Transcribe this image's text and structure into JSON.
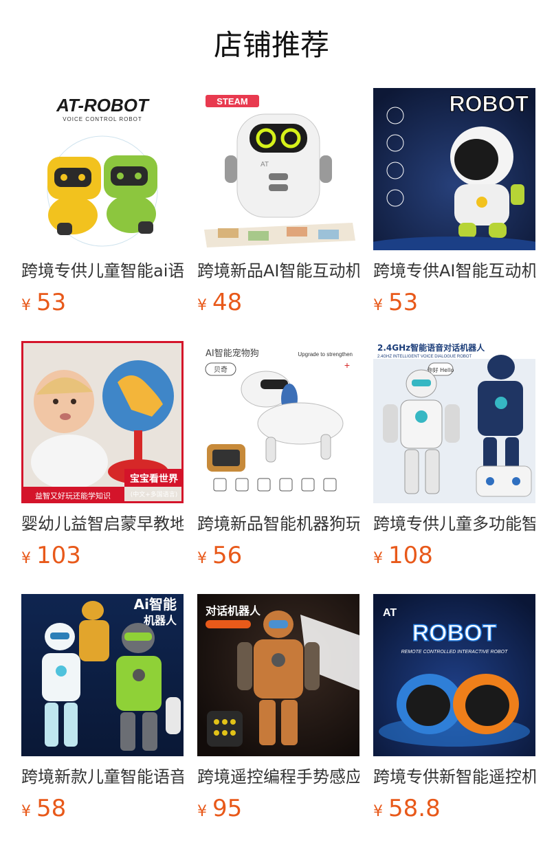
{
  "page": {
    "title": "店铺推荐"
  },
  "colors": {
    "price": "#e8591a",
    "title": "#111111"
  },
  "products": [
    {
      "name": "跨境专供儿童智能ai语音对话机器人",
      "currency": "¥",
      "price": "53",
      "image_text": [
        "AT-ROBOT",
        "VOICE CONTROL ROBOT"
      ]
    },
    {
      "name": "跨境新品AI智能互动机器人",
      "currency": "¥",
      "price": "48",
      "image_text": [
        "STEAM",
        "AT"
      ]
    },
    {
      "name": "跨境专供AI智能互动机器人",
      "currency": "¥",
      "price": "53",
      "image_text": [
        "ROBOT"
      ]
    },
    {
      "name": "婴幼儿益智启蒙早教地球仪",
      "currency": "¥",
      "price": "103",
      "image_text": [
        "宝宝看世界",
        "(中文+多国语言)",
        "益智又好玩还能学知识"
      ]
    },
    {
      "name": "跨境新品智能机器狗玩具",
      "currency": "¥",
      "price": "56",
      "image_text": [
        "AI智能宠物狗",
        "贝奇",
        "Upgrade to strengthen"
      ]
    },
    {
      "name": "跨境专供儿童多功能智能机器人",
      "currency": "¥",
      "price": "108",
      "image_text": [
        "2.4GHz智能语音对话机器人",
        "2.4GHZ INTELLIGENT VOICE DIALOGUE ROBOT",
        "你好 Hello"
      ]
    },
    {
      "name": "跨境新款儿童智能语音机器人",
      "currency": "¥",
      "price": "58",
      "image_text": [
        "Ai智能",
        "机器人"
      ]
    },
    {
      "name": "跨境遥控编程手势感应机器人",
      "currency": "¥",
      "price": "95",
      "image_text": [
        "对话机器人"
      ]
    },
    {
      "name": "跨境专供新智能遥控机器人",
      "currency": "¥",
      "price": "58.8",
      "image_text": [
        "AT",
        "ROBOT",
        "REMOTE CONTROLLED INTERACTIVE ROBOT"
      ]
    }
  ]
}
